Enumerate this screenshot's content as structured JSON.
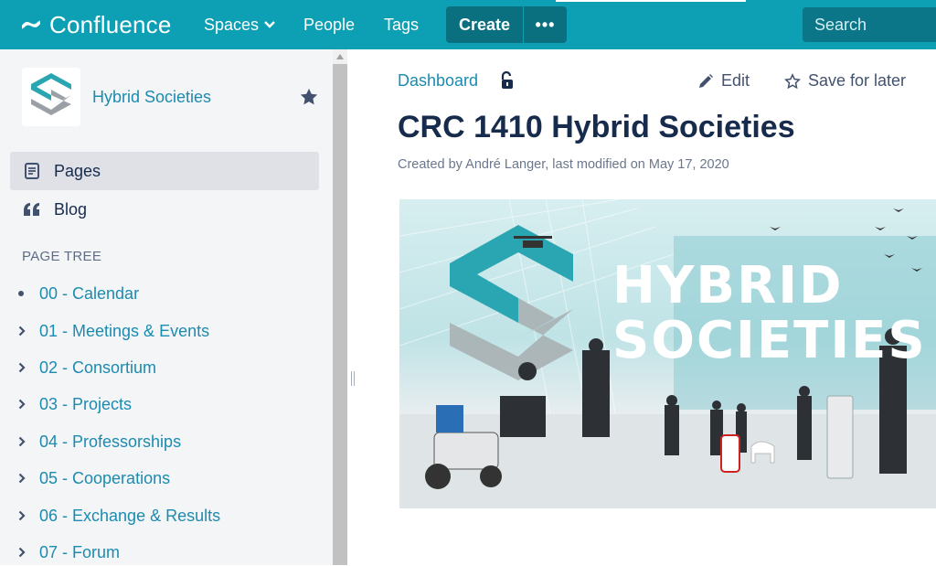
{
  "topnav": {
    "app_name": "Confluence",
    "spaces_label": "Spaces",
    "people_label": "People",
    "tags_label": "Tags",
    "create_label": "Create",
    "more_label": "•••",
    "search_placeholder": "Search",
    "brand_color": "#0d9fb4"
  },
  "sidebar": {
    "space_name": "Hybrid Societies",
    "pages_label": "Pages",
    "blog_label": "Blog",
    "tree_heading": "PAGE TREE",
    "tree_items": [
      {
        "label": "00 - Calendar",
        "marker": "bullet"
      },
      {
        "label": "01 - Meetings & Events",
        "marker": "chevron-right"
      },
      {
        "label": "02 - Consortium",
        "marker": "chevron-right"
      },
      {
        "label": "03 - Projects",
        "marker": "chevron-right"
      },
      {
        "label": "04 - Professorships",
        "marker": "chevron-right"
      },
      {
        "label": "05 - Cooperations",
        "marker": "chevron-right"
      },
      {
        "label": "06 - Exchange & Results",
        "marker": "chevron-right"
      },
      {
        "label": "07 - Forum",
        "marker": "chevron-right"
      }
    ]
  },
  "main": {
    "breadcrumb": "Dashboard",
    "edit_label": "Edit",
    "save_label": "Save for later",
    "title": "CRC 1410 Hybrid Societies",
    "byline": "Created by André Langer, last modified on May 17, 2020",
    "banner": {
      "line1": "HYBRID",
      "line2": "SOCIETIES"
    }
  }
}
